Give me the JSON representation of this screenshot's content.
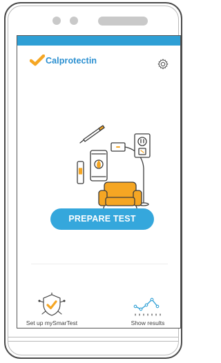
{
  "app": {
    "brand_name": "Calprotectin",
    "accent_color": "#2e9fd5",
    "logo_check_color": "#f5a623"
  },
  "header": {
    "settings_icon": "gear-icon"
  },
  "main": {
    "hero_illustration": "home-test-kit-illustration",
    "primary_button_label": "PREPARE TEST"
  },
  "bottom_actions": [
    {
      "label": "Set up mySmarTest",
      "icon": "shield-check-icon"
    },
    {
      "label": "Show results",
      "icon": "line-graph-icon"
    }
  ]
}
